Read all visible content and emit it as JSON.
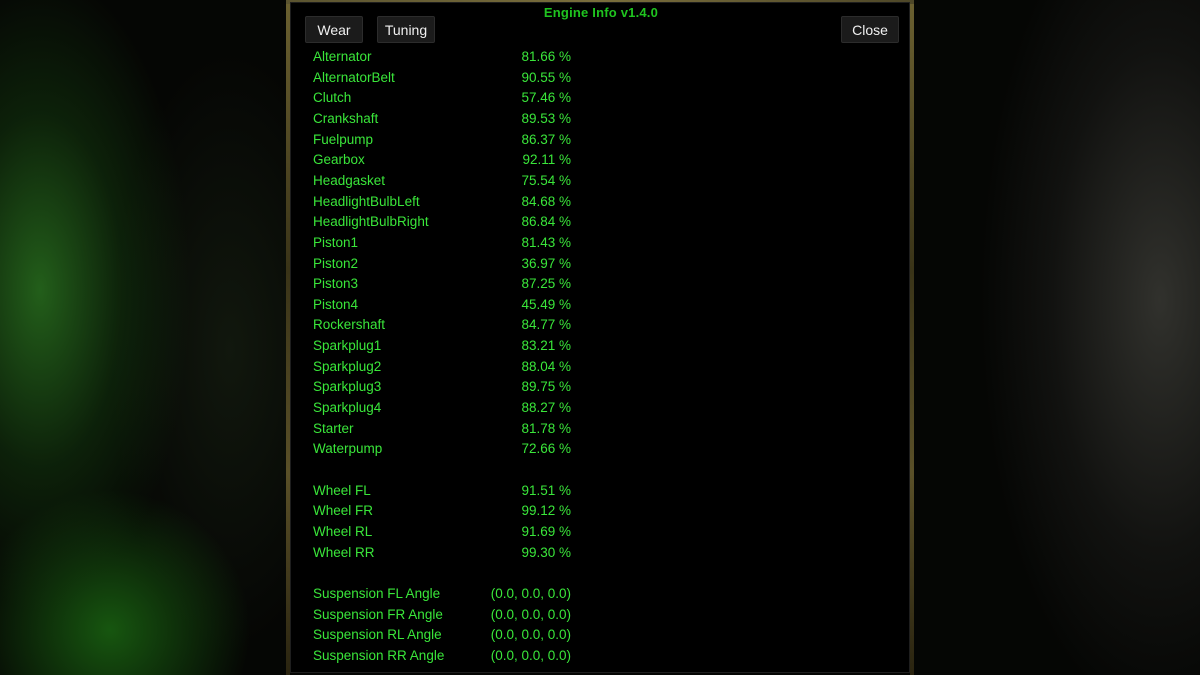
{
  "window": {
    "title": "Engine Info  v1.4.0",
    "buttons": {
      "wear": "Wear",
      "tuning": "Tuning",
      "close": "Close"
    }
  },
  "colors": {
    "text_green": "#3ae63a",
    "title_green": "#1fc41f",
    "button_bg": "#1b1b1b",
    "button_text": "#f0f0f0"
  },
  "engine_parts": [
    {
      "name": "Alternator",
      "value": "81.66 %"
    },
    {
      "name": "AlternatorBelt",
      "value": "90.55 %"
    },
    {
      "name": "Clutch",
      "value": "57.46 %"
    },
    {
      "name": "Crankshaft",
      "value": "89.53 %"
    },
    {
      "name": "Fuelpump",
      "value": "86.37 %"
    },
    {
      "name": "Gearbox",
      "value": "92.11 %"
    },
    {
      "name": "Headgasket",
      "value": "75.54 %"
    },
    {
      "name": "HeadlightBulbLeft",
      "value": "84.68 %"
    },
    {
      "name": "HeadlightBulbRight",
      "value": "86.84 %"
    },
    {
      "name": "Piston1",
      "value": "81.43 %"
    },
    {
      "name": "Piston2",
      "value": "36.97 %"
    },
    {
      "name": "Piston3",
      "value": "87.25 %"
    },
    {
      "name": "Piston4",
      "value": "45.49 %"
    },
    {
      "name": "Rockershaft",
      "value": "84.77 %"
    },
    {
      "name": "Sparkplug1",
      "value": "83.21 %"
    },
    {
      "name": "Sparkplug2",
      "value": "88.04 %"
    },
    {
      "name": "Sparkplug3",
      "value": "89.75 %"
    },
    {
      "name": "Sparkplug4",
      "value": "88.27 %"
    },
    {
      "name": "Starter",
      "value": "81.78 %"
    },
    {
      "name": "Waterpump",
      "value": "72.66 %"
    }
  ],
  "wheels": [
    {
      "name": "Wheel FL",
      "value": "91.51 %"
    },
    {
      "name": "Wheel FR",
      "value": "99.12 %"
    },
    {
      "name": "Wheel RL",
      "value": "91.69 %"
    },
    {
      "name": "Wheel RR",
      "value": "99.30 %"
    }
  ],
  "suspension": [
    {
      "name": "Suspension FL Angle",
      "value": "(0.0, 0.0, 0.0)"
    },
    {
      "name": "Suspension FR Angle",
      "value": "(0.0, 0.0, 0.0)"
    },
    {
      "name": "Suspension RL Angle",
      "value": "(0.0, 0.0, 0.0)"
    },
    {
      "name": "Suspension RR Angle",
      "value": "(0.0, 0.0, 0.0)"
    }
  ]
}
